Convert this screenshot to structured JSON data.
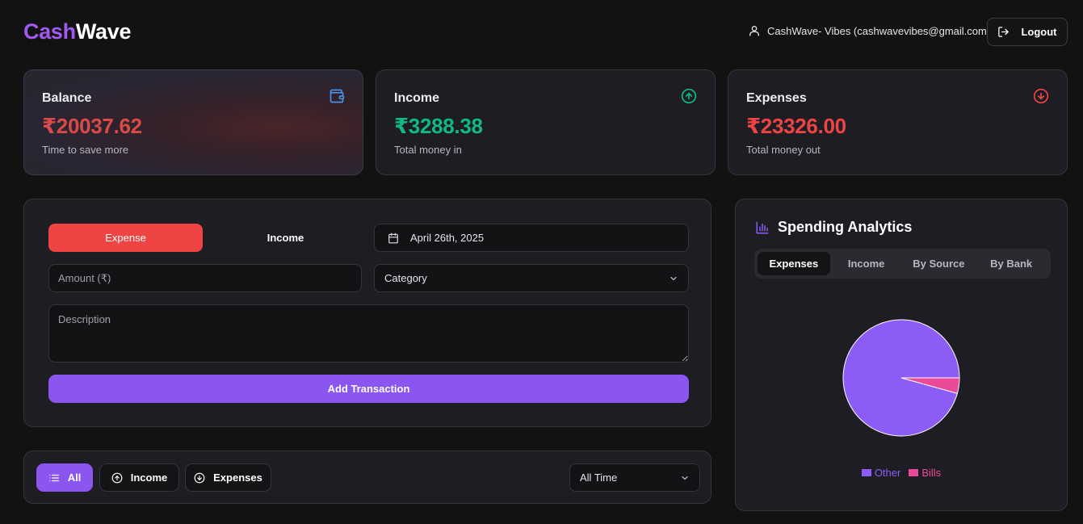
{
  "header": {
    "logo_part1": "Cash",
    "logo_part2": "Wave",
    "user_text": "CashWave- Vibes (cashwavevibes@gmail.com)",
    "logout_label": "Logout"
  },
  "stats": {
    "balance": {
      "title": "Balance",
      "value": "₹20037.62",
      "subtitle": "Time to save more",
      "color": "#d94a4a",
      "icon": "wallet-icon"
    },
    "income": {
      "title": "Income",
      "value": "₹3288.38",
      "subtitle": "Total money in",
      "color": "#10b981",
      "icon": "arrow-up-circle-icon"
    },
    "expenses": {
      "title": "Expenses",
      "value": "₹23326.00",
      "subtitle": "Total money out",
      "color": "#ef4444",
      "icon": "arrow-down-circle-icon"
    }
  },
  "form": {
    "type_expense_label": "Expense",
    "type_income_label": "Income",
    "date_value": "April 26th, 2025",
    "amount_placeholder": "Amount (₹)",
    "category_value": "Category",
    "description_placeholder": "Description",
    "submit_label": "Add Transaction"
  },
  "filters": {
    "all_label": "All",
    "income_label": "Income",
    "expenses_label": "Expenses",
    "time_range_value": "All Time"
  },
  "analytics": {
    "title": "Spending Analytics",
    "tabs": [
      {
        "label": "Expenses",
        "active": true
      },
      {
        "label": "Income",
        "active": false
      },
      {
        "label": "By Source",
        "active": false
      },
      {
        "label": "By Bank",
        "active": false
      }
    ]
  },
  "colors": {
    "accent_purple": "#8b55ef",
    "expense_red": "#ef4444",
    "income_green": "#10b981",
    "bills_pink": "#ec4899"
  },
  "chart_data": {
    "type": "pie",
    "categories": [
      "Other",
      "Bills"
    ],
    "values": [
      95.7,
      4.3
    ],
    "colors": [
      "#8b5cf6",
      "#ec4899"
    ],
    "legend_position": "bottom"
  }
}
